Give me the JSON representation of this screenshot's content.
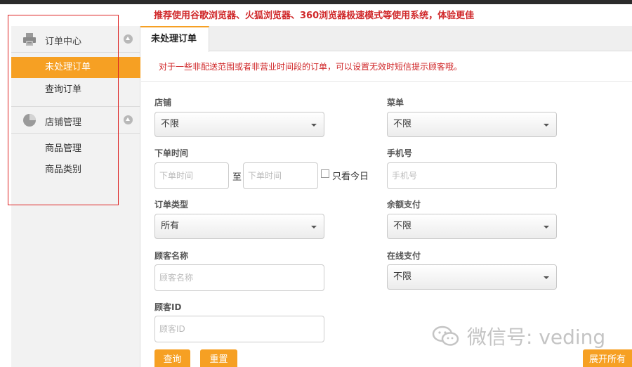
{
  "notice": "推荐使用谷歌浏览器、火狐浏览器、360浏览器极速模式等使用系统，体验更佳",
  "sidebar": {
    "sections": [
      {
        "label": "订单中心",
        "icon": "printer-icon"
      },
      {
        "label": "店铺管理",
        "icon": "pie-chart-icon"
      }
    ],
    "order_items": [
      "未处理订单",
      "查询订单"
    ],
    "shop_items": [
      "商品管理",
      "商品类别"
    ],
    "active_color": "#f6a023"
  },
  "tab": {
    "label": "未处理订单"
  },
  "tip": "对于一些非配送范围或者非营业时间段的订单，可以设置无效时短信提示顾客哦。",
  "form": {
    "shop": {
      "label": "店铺",
      "value": "不限"
    },
    "menu": {
      "label": "菜单",
      "value": "不限"
    },
    "order_time": {
      "label": "下单时间",
      "from_placeholder": "下单时间",
      "to_text": "至",
      "to_placeholder": "下单时间",
      "today_only": "只看今日"
    },
    "phone": {
      "label": "手机号",
      "placeholder": "手机号"
    },
    "order_type": {
      "label": "订单类型",
      "value": "所有"
    },
    "balance_pay": {
      "label": "余额支付",
      "value": "不限"
    },
    "customer_name": {
      "label": "顾客名称",
      "placeholder": "顾客名称"
    },
    "online_pay": {
      "label": "在线支付",
      "value": "不限"
    },
    "customer_id": {
      "label": "顾客ID",
      "placeholder": "顾客ID"
    }
  },
  "buttons": {
    "query": "查询",
    "reset": "重置",
    "expand_all": "展开所有"
  },
  "watermark": "微信号: veding"
}
